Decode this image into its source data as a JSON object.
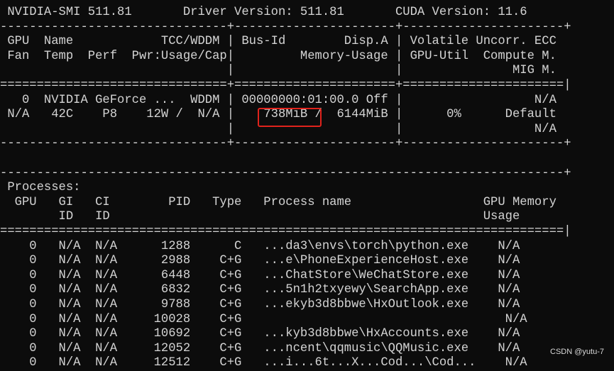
{
  "terminal": {
    "lines": [
      " NVIDIA-SMI 511.81       Driver Version: 511.81       CUDA Version: 11.6     ",
      "-------------------------------+----------------------+----------------------+",
      " GPU  Name            TCC/WDDM | Bus-Id        Disp.A | Volatile Uncorr. ECC ",
      " Fan  Temp  Perf  Pwr:Usage/Cap|         Memory-Usage | GPU-Util  Compute M. ",
      "                               |                      |               MIG M. ",
      "===============================+======================+======================|",
      "   0  NVIDIA GeForce ...  WDDM | 00000000:01:00.0 Off |                  N/A ",
      " N/A   42C    P8    12W /  N/A |    738MiB /  6144MiB |      0%      Default ",
      "                               |                      |                  N/A ",
      "-------------------------------+----------------------+----------------------+",
      "",
      "-----------------------------------------------------------------------------+",
      " Processes:                                                                  ",
      "  GPU   GI   CI        PID   Type   Process name                  GPU Memory ",
      "        ID   ID                                                   Usage      ",
      "=============================================================================|",
      "    0   N/A  N/A      1288      C   ...da3\\envs\\torch\\python.exe    N/A      ",
      "    0   N/A  N/A      2988    C+G   ...e\\PhoneExperienceHost.exe    N/A      ",
      "    0   N/A  N/A      6448    C+G   ...ChatStore\\WeChatStore.exe    N/A      ",
      "    0   N/A  N/A      6832    C+G   ...5n1h2txyewy\\SearchApp.exe    N/A      ",
      "    0   N/A  N/A      9788    C+G   ...ekyb3d8bbwe\\HxOutlook.exe    N/A      ",
      "    0   N/A  N/A     10028    C+G                                    N/A      ",
      "    0   N/A  N/A     10692    C+G   ...kyb3d8bbwe\\HxAccounts.exe    N/A      ",
      "    0   N/A  N/A     12052    C+G   ...ncent\\qqmusic\\QQMusic.exe    N/A      ",
      "    0   N/A  N/A     12512    C+G   ...i...6t...X...Cod...\\Cod...    N/A      "
    ],
    "highlighted_value": "738MiB",
    "highlight_color": "#e0231c"
  },
  "watermark": "CSDN @yutu-7"
}
